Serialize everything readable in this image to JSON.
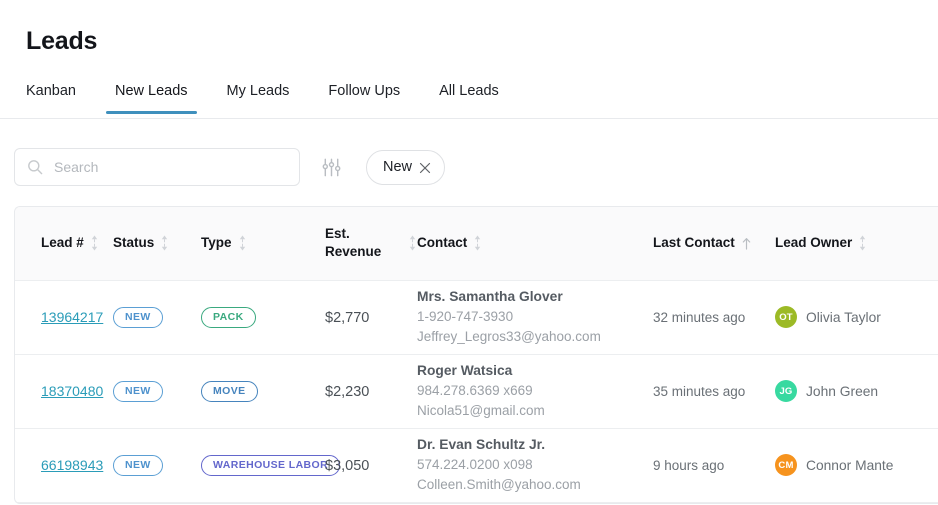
{
  "header": {
    "title": "Leads"
  },
  "tabs": [
    {
      "label": "Kanban",
      "active": false
    },
    {
      "label": "New Leads",
      "active": true
    },
    {
      "label": "My Leads",
      "active": false
    },
    {
      "label": "Follow Ups",
      "active": false
    },
    {
      "label": "All Leads",
      "active": false
    }
  ],
  "toolbar": {
    "search_placeholder": "Search",
    "search_value": "",
    "search_icon": "search-icon",
    "filter_icon": "filter-sliders-icon",
    "chip": {
      "label": "New",
      "close_icon": "close-icon"
    }
  },
  "table": {
    "columns": [
      {
        "label": "Lead #",
        "sort": "both"
      },
      {
        "label": "Status",
        "sort": "both"
      },
      {
        "label": "Type",
        "sort": "both"
      },
      {
        "label": "Est. Revenue",
        "sort": "both"
      },
      {
        "label": "Contact",
        "sort": "both"
      },
      {
        "label": "Last Contact",
        "sort": "asc"
      },
      {
        "label": "Lead Owner",
        "sort": "both"
      }
    ],
    "rows": [
      {
        "lead_number": "13964217",
        "status": "NEW",
        "type": "PACK",
        "type_color": "#3aa97f",
        "est_revenue": "$2,770",
        "contact_name": "Mrs. Samantha Glover",
        "contact_phone": "1-920-747-3930",
        "contact_email": "Jeffrey_Legros33@yahoo.com",
        "last_contact": "32 minutes ago",
        "owner_initials": "OT",
        "owner_name": "Olivia Taylor",
        "owner_color": "#9cba26"
      },
      {
        "lead_number": "18370480",
        "status": "NEW",
        "type": "MOVE",
        "type_color": "#4684bd",
        "est_revenue": "$2,230",
        "contact_name": "Roger Watsica",
        "contact_phone": "984.278.6369 x669",
        "contact_email": "Nicola51@gmail.com",
        "last_contact": "35 minutes ago",
        "owner_initials": "JG",
        "owner_name": "John Green",
        "owner_color": "#38d9a0"
      },
      {
        "lead_number": "66198943",
        "status": "NEW",
        "type": "WAREHOUSE LABOR",
        "type_color": "#6367cc",
        "est_revenue": "$3,050",
        "contact_name": "Dr. Evan Schultz Jr.",
        "contact_phone": "574.224.0200 x098",
        "contact_email": "Colleen.Smith@yahoo.com",
        "last_contact": "9 hours ago",
        "owner_initials": "CM",
        "owner_name": "Connor Mante",
        "owner_color": "#f6931e"
      }
    ]
  },
  "colors": {
    "accent_tab": "#3f90bd",
    "link": "#2a9cb8",
    "status_badge": "#4e92cd",
    "header_bg": "#fafafb",
    "border": "#eceef0"
  }
}
